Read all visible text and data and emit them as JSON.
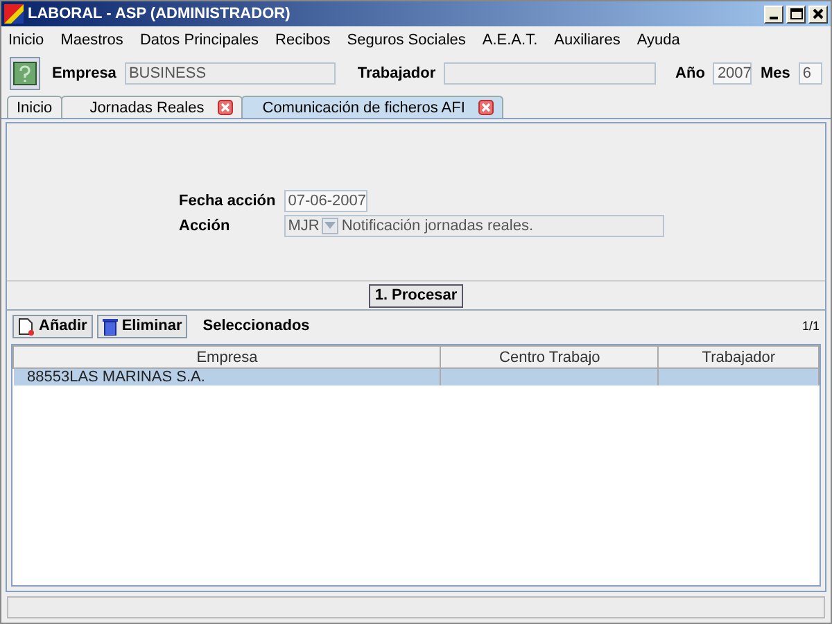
{
  "window": {
    "title": "LABORAL - ASP (ADMINISTRADOR)"
  },
  "menu": [
    "Inicio",
    "Maestros",
    "Datos Principales",
    "Recibos",
    "Seguros Sociales",
    "A.E.A.T.",
    "Auxiliares",
    "Ayuda"
  ],
  "toolbar": {
    "empresa_label": "Empresa",
    "empresa_value": "BUSINESS",
    "trabajador_label": "Trabajador",
    "ano_label": "Año",
    "ano_value": "2007",
    "mes_label": "Mes",
    "mes_value": "6"
  },
  "tabs": [
    {
      "label": "Inicio",
      "selected": false,
      "closable": false
    },
    {
      "label": "Jornadas Reales",
      "selected": false,
      "closable": true
    },
    {
      "label": "Comunicación de ficheros AFI",
      "selected": true,
      "closable": true
    }
  ],
  "form": {
    "fecha_label": "Fecha acción",
    "fecha_value": "07-06-2007",
    "accion_label": "Acción",
    "accion_code": "MJR",
    "accion_value": "Notificación jornadas reales."
  },
  "process_button": "1. Procesar",
  "list_toolbar": {
    "add_button": "Añadir",
    "delete_button": "Eliminar",
    "title": "Seleccionados",
    "page": "1/1"
  },
  "table": {
    "columns": [
      "Empresa",
      "Centro Trabajo",
      "Trabajador"
    ],
    "rows": [
      {
        "cells": [
          "88553LAS MARINAS S.A.",
          "",
          ""
        ],
        "selected": true
      }
    ]
  }
}
